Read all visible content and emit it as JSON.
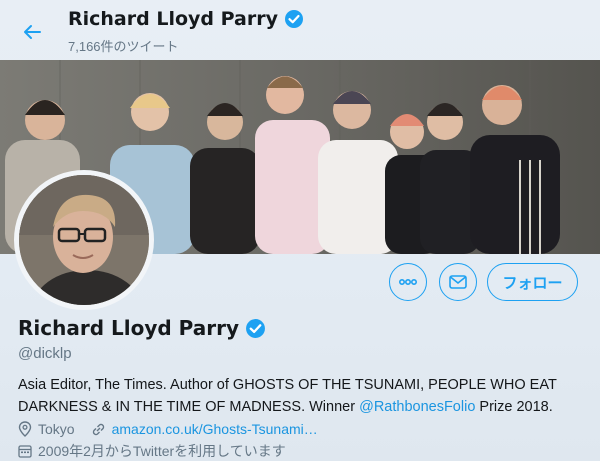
{
  "header": {
    "name": "Richard Lloyd Parry",
    "tweet_count": "7,166件のツイート"
  },
  "profile": {
    "name": "Richard Lloyd Parry",
    "handle": "@dicklp",
    "bio_part1": "Asia Editor, The Times. Author of GHOSTS OF THE TSUNAMI, PEOPLE WHO EAT DARKNESS & IN THE TIME OF MADNESS. Winner ",
    "bio_link": "@RathbonesFolio",
    "bio_part2": " Prize 2018.",
    "location": "Tokyo",
    "website": "amazon.co.uk/Ghosts-Tsunami…",
    "joined": "2009年2月からTwitterを利用しています"
  },
  "actions": {
    "follow_label": "フォロー"
  },
  "icons": {
    "back": "back-arrow-icon",
    "verified": "verified-badge-icon",
    "more": "more-icon",
    "message": "message-icon",
    "location": "location-icon",
    "link": "link-icon",
    "calendar": "calendar-icon"
  },
  "colors": {
    "accent": "#1da1f2",
    "link": "#1b95e0",
    "muted": "#657786"
  }
}
